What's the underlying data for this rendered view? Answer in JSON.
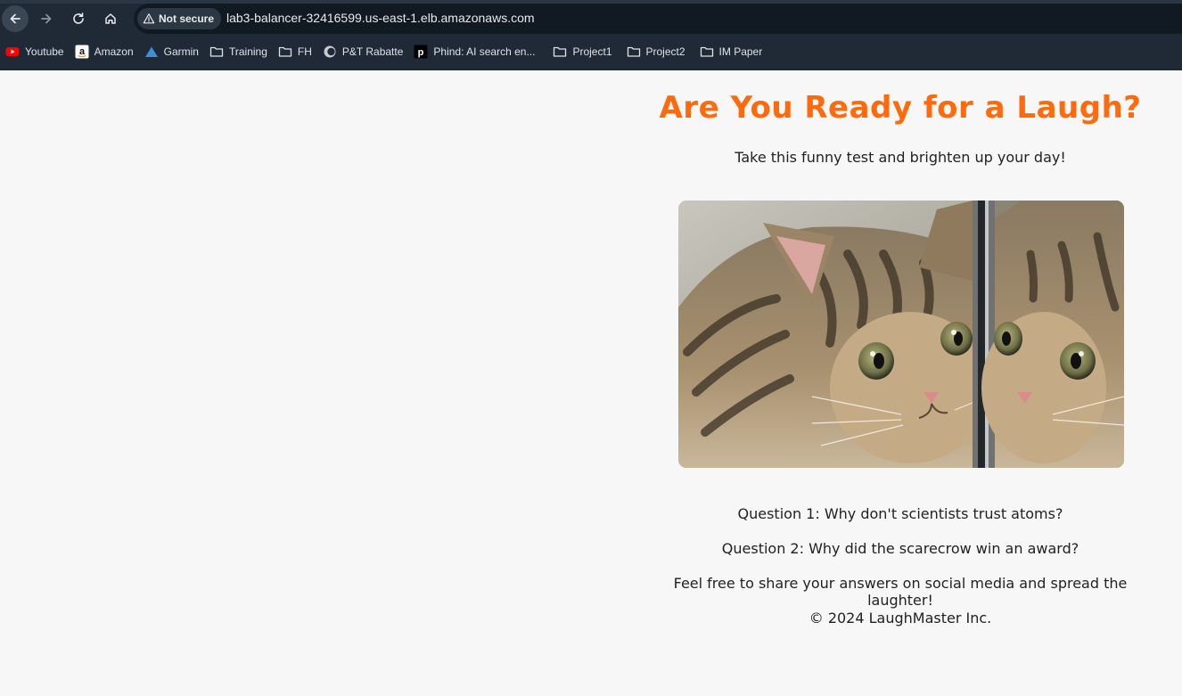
{
  "browser": {
    "security_label": "Not secure",
    "url": "lab3-balancer-32416599.us-east-1.elb.amazonaws.com",
    "bookmarks": [
      {
        "label": "Youtube",
        "icon": "youtube-icon"
      },
      {
        "label": "Amazon",
        "icon": "amazon-icon"
      },
      {
        "label": "Garmin",
        "icon": "garmin-icon"
      },
      {
        "label": "Training",
        "icon": "folder-icon"
      },
      {
        "label": "FH",
        "icon": "folder-icon"
      },
      {
        "label": "P&T Rabatte",
        "icon": "pt-icon"
      },
      {
        "label": "Phind: AI search en...",
        "icon": "phind-icon"
      },
      {
        "label": "Project1",
        "icon": "folder-icon"
      },
      {
        "label": "Project2",
        "icon": "folder-icon"
      },
      {
        "label": "IM Paper",
        "icon": "folder-icon"
      }
    ]
  },
  "page": {
    "title": "Are You Ready for a Laugh?",
    "subtitle": "Take this funny test and brighten up your day!",
    "question1": "Question 1: Why don't scientists trust atoms?",
    "question2": "Question 2: Why did the scarecrow win an award?",
    "share_note": "Feel free to share your answers on social media and spread the laughter!",
    "footer": "© 2024 LaughMaster Inc."
  },
  "colors": {
    "title": "#ff6a0d",
    "page_background": "#f7f7f7",
    "chrome_background": "#1f2a36"
  }
}
